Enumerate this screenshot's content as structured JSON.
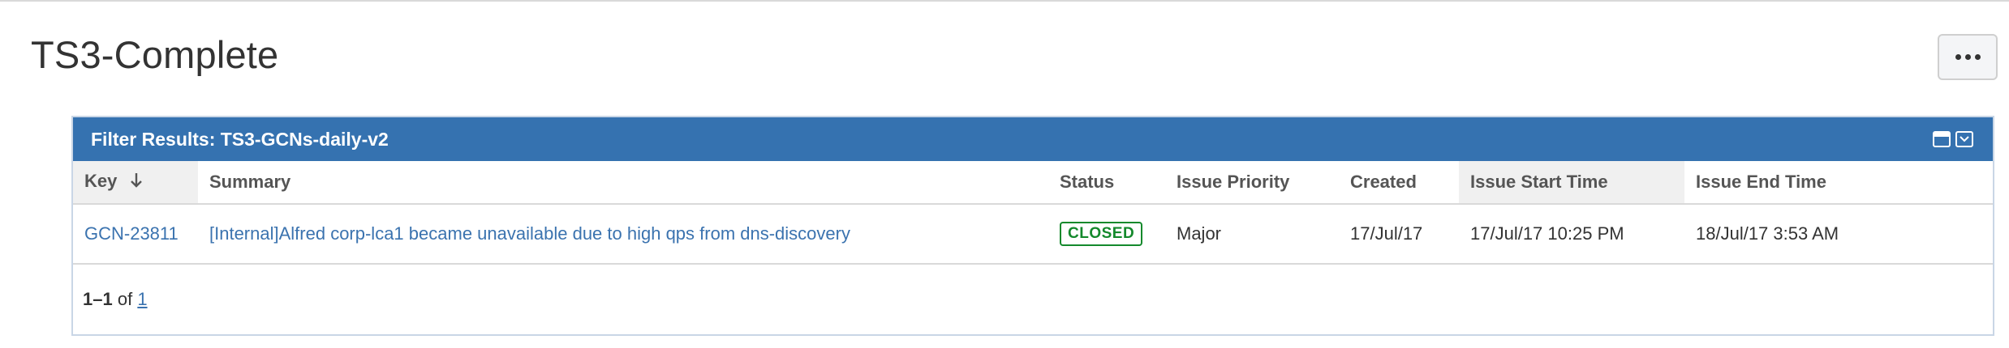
{
  "page": {
    "title": "TS3-Complete",
    "more_label": "more-actions"
  },
  "gadget": {
    "title": "Filter Results: TS3-GCNs-daily-v2",
    "controls": [
      "maximize-icon",
      "gadget-menu-icon"
    ],
    "header_color": "#3572b0"
  },
  "table": {
    "columns": [
      "Key",
      "Summary",
      "Status",
      "Issue Priority",
      "Created",
      "Issue Start Time",
      "Issue End Time"
    ],
    "sort_icon": "arrow-down-icon",
    "rows": [
      {
        "key": "GCN-23811",
        "summary": "[Internal]Alfred corp-lca1 became unavailable due to high qps from dns-discovery",
        "status": "CLOSED",
        "priority": "Major",
        "created": "17/Jul/17",
        "start": "17/Jul/17 10:25 PM",
        "end": "18/Jul/17 3:53 AM"
      }
    ]
  },
  "pagination": {
    "range": "1–1",
    "of": "of",
    "total": "1"
  },
  "colors": {
    "link": "#3b73af",
    "status_closed": "#14892c"
  }
}
